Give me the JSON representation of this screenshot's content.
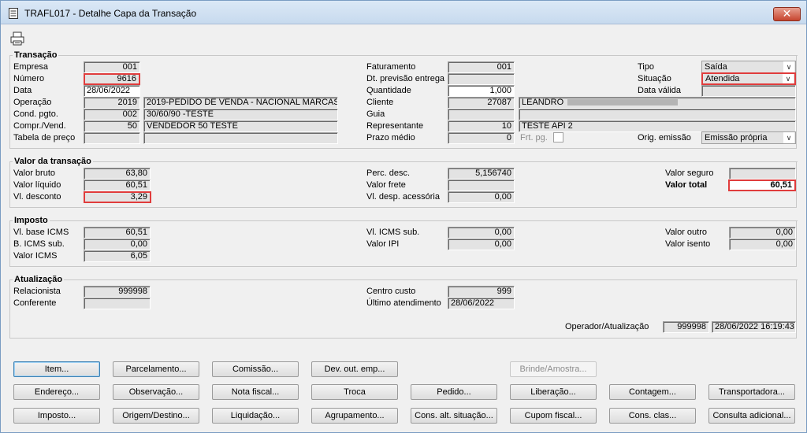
{
  "window": {
    "title": "TRAFL017 - Detalhe Capa da Transação",
    "close_label": "✕"
  },
  "transacao": {
    "title": "Transação",
    "empresa": {
      "label": "Empresa",
      "value": "001"
    },
    "numero": {
      "label": "Número",
      "value": "9616"
    },
    "data": {
      "label": "Data",
      "value": "28/06/2022"
    },
    "operacao": {
      "label": "Operação",
      "code": "2019",
      "desc": "2019-PEDIDO DE VENDA - NACIONAL MARCAS"
    },
    "cond_pgto": {
      "label": "Cond. pgto.",
      "code": "002",
      "desc": "30/60/90 -TESTE"
    },
    "compr_vend": {
      "label": "Compr./Vend.",
      "code": "50",
      "desc": "VENDEDOR 50 TESTE"
    },
    "tabela_preco": {
      "label": "Tabela de preço",
      "code": "",
      "desc": ""
    },
    "faturamento": {
      "label": "Faturamento",
      "value": "001"
    },
    "dt_previsao": {
      "label": "Dt. previsão entrega",
      "value": ""
    },
    "quantidade": {
      "label": "Quantidade",
      "value": "1,000"
    },
    "cliente": {
      "label": "Cliente",
      "code": "27087",
      "name": "LEANDRO"
    },
    "guia": {
      "label": "Guia",
      "code": "",
      "name": ""
    },
    "representante": {
      "label": "Representante",
      "code": "10",
      "name": "TESTE API 2"
    },
    "prazo_medio": {
      "label": "Prazo médio",
      "value": "0"
    },
    "frt_pg": {
      "label": "Frt. pg."
    },
    "tipo": {
      "label": "Tipo",
      "value": "Saída"
    },
    "situacao": {
      "label": "Situação",
      "value": "Atendida"
    },
    "data_valida": {
      "label": "Data válida",
      "value": ""
    },
    "orig_emissao": {
      "label": "Orig. emissão",
      "value": "Emissão própria"
    }
  },
  "valor": {
    "title": "Valor da transação",
    "valor_bruto": {
      "label": "Valor bruto",
      "value": "63,80"
    },
    "valor_liquido": {
      "label": "Valor líquido",
      "value": "60,51"
    },
    "vl_desconto": {
      "label": "Vl. desconto",
      "value": "3,29"
    },
    "perc_desc": {
      "label": "Perc. desc.",
      "value": "5,156740"
    },
    "valor_frete": {
      "label": "Valor frete",
      "value": ""
    },
    "vl_desp_acessoria": {
      "label": "Vl. desp. acessória",
      "value": "0,00"
    },
    "valor_seguro": {
      "label": "Valor seguro",
      "value": ""
    },
    "valor_total": {
      "label": "Valor total",
      "value": "60,51"
    }
  },
  "imposto": {
    "title": "Imposto",
    "vl_base_icms": {
      "label": "Vl. base ICMS",
      "value": "60,51"
    },
    "b_icms_sub": {
      "label": "B. ICMS sub.",
      "value": "0,00"
    },
    "valor_icms": {
      "label": "Valor ICMS",
      "value": "6,05"
    },
    "vl_icms_sub": {
      "label": "Vl. ICMS sub.",
      "value": "0,00"
    },
    "valor_ipi": {
      "label": "Valor IPI",
      "value": "0,00"
    },
    "valor_outro": {
      "label": "Valor outro",
      "value": "0,00"
    },
    "valor_isento": {
      "label": "Valor isento",
      "value": "0,00"
    }
  },
  "atualizacao": {
    "title": "Atualização",
    "relacionista": {
      "label": "Relacionista",
      "value": "999998"
    },
    "conferente": {
      "label": "Conferente",
      "value": ""
    },
    "centro_custo": {
      "label": "Centro custo",
      "value": "999"
    },
    "ultimo_atendimento": {
      "label": "Último atendimento",
      "value": "28/06/2022"
    },
    "operador": {
      "label": "Operador/Atualização",
      "code": "999998",
      "datetime": "28/06/2022 16:19:43"
    }
  },
  "buttons": {
    "row1": [
      "Item...",
      "Parcelamento...",
      "Comissão...",
      "Dev. out. emp...",
      "Brinde/Amostra..."
    ],
    "row2": [
      "Endereço...",
      "Observação...",
      "Nota fiscal...",
      "Troca",
      "Pedido...",
      "Liberação...",
      "Contagem...",
      "Transportadora..."
    ],
    "row3": [
      "Imposto...",
      "Origem/Destino...",
      "Liquidação...",
      "Agrupamento...",
      "Cons. alt. situação...",
      "Cupom fiscal...",
      "Cons. clas...",
      "Consulta adicional..."
    ]
  },
  "icons": {
    "app": "document-icon",
    "print": "printer-icon"
  }
}
